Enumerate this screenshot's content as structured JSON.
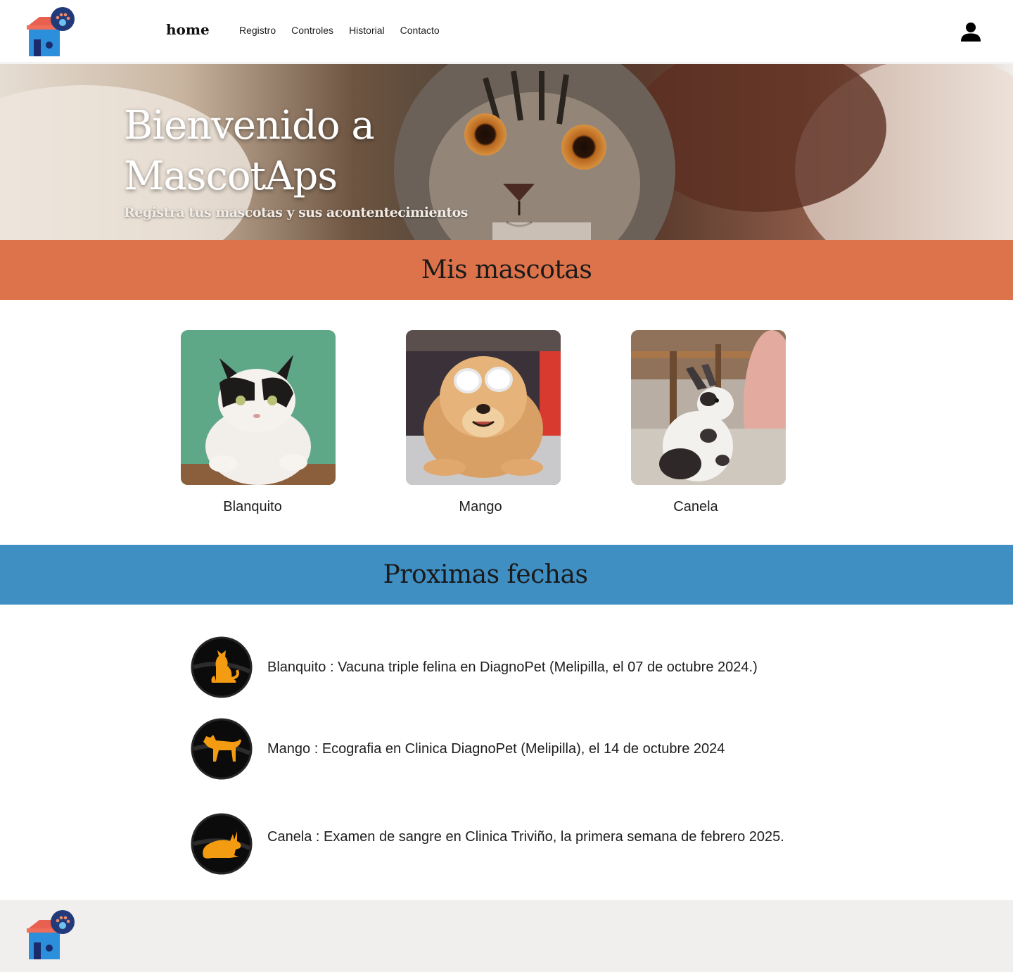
{
  "header": {
    "brand": "home",
    "nav": [
      "Registro",
      "Controles",
      "Historial",
      "Contacto"
    ]
  },
  "hero": {
    "title": "Bienvenido a MascotAps",
    "subtitle": "Registra tus mascotas y sus acontentecimientos"
  },
  "pets_section": {
    "title": "Mis mascotas",
    "pets": [
      {
        "name": "Blanquito",
        "photo": "cat-photo"
      },
      {
        "name": "Mango",
        "photo": "dog-photo"
      },
      {
        "name": "Canela",
        "photo": "rabbit-photo"
      }
    ]
  },
  "events_section": {
    "title": "Proximas fechas",
    "events": [
      {
        "icon": "cat-icon",
        "text": "Blanquito : Vacuna triple felina en DiagnoPet (Melipilla, el 07 de octubre 2024.)"
      },
      {
        "icon": "dog-icon",
        "text": "Mango : Ecografia en Clinica DiagnoPet (Melipilla), el 14 de octubre 2024"
      },
      {
        "icon": "rabbit-icon",
        "text": "Canela : Examen de sangre en Clinica Triviño, la primera semana de febrero 2025."
      }
    ]
  },
  "colors": {
    "orange_bar": "#dc734b",
    "blue_bar": "#3f8fc3",
    "footer_bg": "#f0efee",
    "icon_fill": "#f39c12"
  }
}
